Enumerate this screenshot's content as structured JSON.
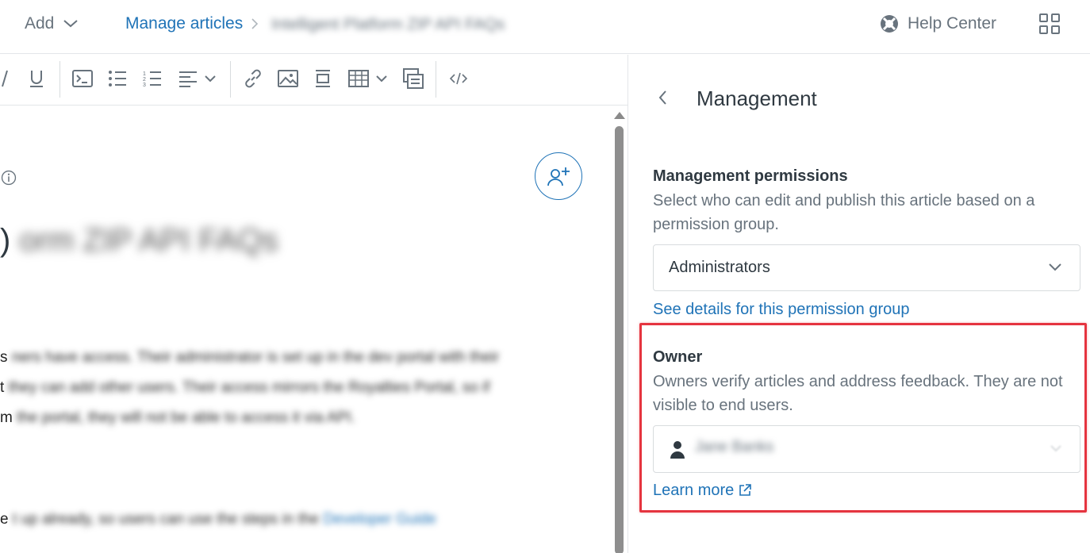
{
  "topbar": {
    "add_label": "Add",
    "breadcrumb_link": "Manage articles",
    "breadcrumb_current": "Intelligent Platform ZIP API FAQs",
    "help_center_label": "Help Center"
  },
  "editor": {
    "title_prefix": ")",
    "title_blurred": "orm ZIP API FAQs",
    "paragraph_1": [
      {
        "lead": "s",
        "rest": "ners have access. Their administrator is set up in the dev portal with their"
      },
      {
        "lead": "t",
        "rest": "they can add other users. Their access mirrors the Royalties Portal, so if"
      },
      {
        "lead": "m",
        "rest": "the portal, they will not be able to access it via API."
      }
    ],
    "paragraph_2": {
      "lead": "e",
      "rest": "t up already, so users can use the steps in the ",
      "link": "Developer Guide"
    }
  },
  "panel": {
    "title": "Management",
    "permissions": {
      "heading": "Management permissions",
      "description": "Select who can edit and publish this article based on a permission group.",
      "selected_value": "Administrators",
      "details_link": "See details for this permission group"
    },
    "owner": {
      "heading": "Owner",
      "description": "Owners verify articles and address feedback. They are not visible to end users.",
      "selected_value": "Jane Banks",
      "learn_more_link": "Learn more"
    }
  },
  "colors": {
    "link": "#1f73b7",
    "highlight": "#e5343f",
    "text": "#2f3941",
    "muted": "#68737d"
  }
}
